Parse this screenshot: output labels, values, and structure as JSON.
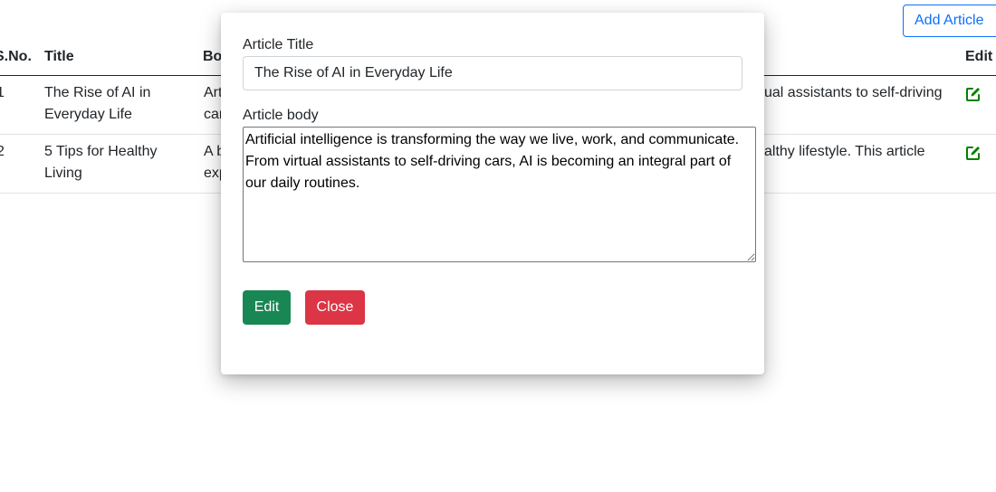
{
  "toolbar": {
    "add_label": "Add Article"
  },
  "table": {
    "headers": {
      "sno": "S.No.",
      "title": "Title",
      "body": "Body",
      "edit": "Edit"
    },
    "rows": [
      {
        "sno": "1",
        "title_line1": "The Rise of AI in",
        "title_line2": "Everyday Life",
        "body_line1_left": "Art",
        "body_line2_left": "car",
        "body_line1_right": "ual assistants to self-driving"
      },
      {
        "sno": "2",
        "title_line1": "5 Tips for Healthy",
        "title_line2": "Living",
        "body_line1_left": "A b",
        "body_line2_left": "exp",
        "body_line1_right": "althy lifestyle. This article"
      }
    ]
  },
  "modal": {
    "title_label": "Article Title",
    "title_value": "The Rise of AI in Everyday Life",
    "body_label": "Article body",
    "body_value": "Artificial intelligence is transforming the way we live, work, and communicate. From virtual assistants to self-driving cars, AI is becoming an integral part of our daily routines.",
    "edit_label": "Edit",
    "close_label": "Close"
  },
  "colors": {
    "primary": "#0d6efd",
    "success": "#198754",
    "danger": "#dc3545",
    "icon_green": "#008000"
  },
  "icons": {
    "row_edit": "edit-square-icon"
  }
}
